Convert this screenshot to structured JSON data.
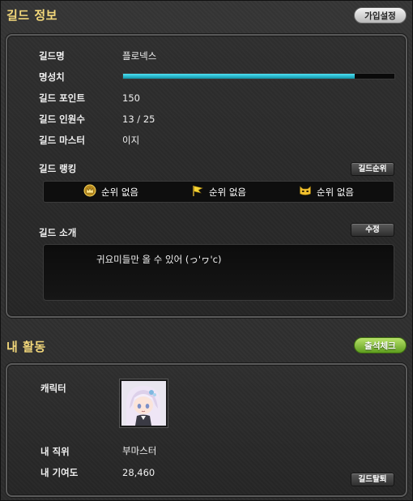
{
  "guild_info": {
    "title": "길드 정보",
    "join_settings_label": "가입설정",
    "fields": {
      "name_label": "길드명",
      "name_value": "플로넥스",
      "fame_label": "명성치",
      "fame_ratio": 0.855,
      "points_label": "길드 포인트",
      "points_value": "150",
      "members_label": "길드 인원수",
      "members_value": "13 / 25",
      "master_label": "길드 마스터",
      "master_value": "이지"
    },
    "ranking": {
      "label": "길드 랭킹",
      "button_label": "길드순위",
      "items": [
        {
          "icon": "crown-icon",
          "text": "순위 없음"
        },
        {
          "icon": "flag-icon",
          "text": "순위 없음"
        },
        {
          "icon": "cat-mask-icon",
          "text": "순위 없음"
        }
      ]
    },
    "intro": {
      "label": "길드 소개",
      "edit_label": "수정",
      "text": "귀요미들만 올 수 있어 (っ'ヮ'c)"
    }
  },
  "my_activity": {
    "title": "내 활동",
    "attendance_label": "출석체크",
    "character_label": "캐릭터",
    "position_label": "내 직위",
    "position_value": "부마스터",
    "contribution_label": "내 기여도",
    "contribution_value": "28,460",
    "leave_label": "길드탈퇴"
  },
  "colors": {
    "section_title": "#f2d77a",
    "fame_bar": "#2bc6dc",
    "attendance_button": "#7cc23a"
  }
}
